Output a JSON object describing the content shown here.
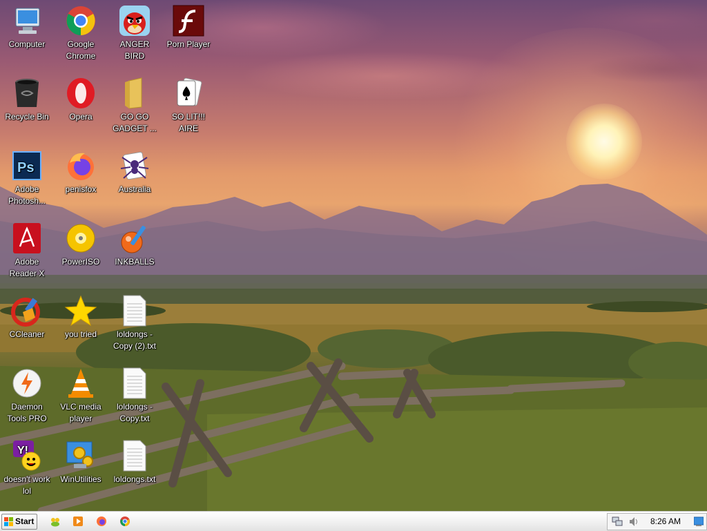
{
  "desktop": {
    "icons": [
      {
        "label": "Computer",
        "icon": "computer-icon"
      },
      {
        "label": "Google Chrome",
        "icon": "chrome-icon"
      },
      {
        "label": "ANGER BIRD",
        "icon": "angry-bird-icon"
      },
      {
        "label": "Porn Player",
        "icon": "flash-player-icon"
      },
      {
        "label": "Recycle Bin",
        "icon": "recycle-bin-icon"
      },
      {
        "label": "Opera",
        "icon": "opera-icon"
      },
      {
        "label": "GO GO GADGET ...",
        "icon": "folder-icon"
      },
      {
        "label": "SO LIT!!! AIRE",
        "icon": "solitaire-icon"
      },
      {
        "label": "Adobe Photosh...",
        "icon": "photoshop-icon"
      },
      {
        "label": "penisfox",
        "icon": "firefox-icon"
      },
      {
        "label": "Australia",
        "icon": "spider-solitaire-icon"
      },
      {
        "label": "Adobe Reader X",
        "icon": "adobe-reader-icon"
      },
      {
        "label": "PowerISO",
        "icon": "poweriso-icon"
      },
      {
        "label": "INKBALLS",
        "icon": "inkball-icon"
      },
      {
        "label": "CCleaner",
        "icon": "ccleaner-icon"
      },
      {
        "label": "you tried",
        "icon": "star-icon"
      },
      {
        "label": "loldongs - Copy (2).txt",
        "icon": "text-file-icon"
      },
      {
        "label": "Daemon Tools PRO",
        "icon": "daemon-tools-icon"
      },
      {
        "label": "VLC media player",
        "icon": "vlc-icon"
      },
      {
        "label": "loldongs - Copy.txt",
        "icon": "text-file-icon"
      },
      {
        "label": "doesn't work lol",
        "icon": "yahoo-messenger-icon"
      },
      {
        "label": "WinUtilities",
        "icon": "winutilities-icon"
      },
      {
        "label": "loldongs.txt",
        "icon": "text-file-icon"
      }
    ]
  },
  "taskbar": {
    "start_label": "Start",
    "quick_launch": [
      "messenger-icon",
      "media-player-icon",
      "firefox-icon",
      "chrome-icon"
    ],
    "tray_icons": [
      "network-icon",
      "volume-icon"
    ],
    "clock": "8:26 AM",
    "show_desktop_icon": "show-desktop-icon"
  },
  "colors": {
    "taskbar": "#f2f2f2",
    "sky_top": "#6e4a74",
    "sky_horizon": "#e39a6b",
    "grass": "#566326"
  }
}
